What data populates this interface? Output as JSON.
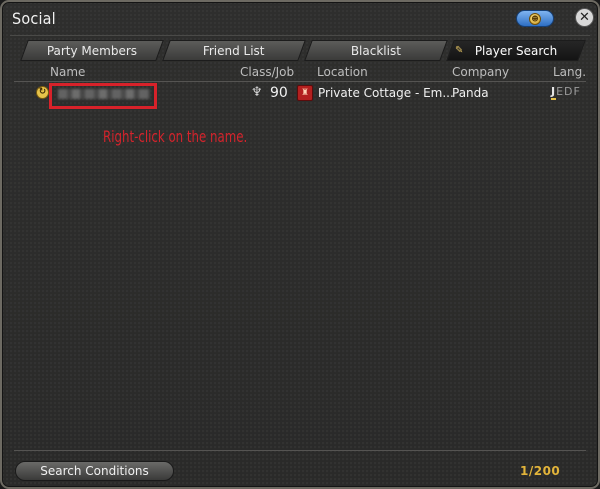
{
  "window": {
    "title": "Social",
    "coin_symbol": "☻",
    "close_symbol": "✕"
  },
  "tabs": [
    {
      "label": "Party Members",
      "active": false
    },
    {
      "label": "Friend List",
      "active": false
    },
    {
      "label": "Blacklist",
      "active": false
    },
    {
      "label": "Player Search",
      "active": true
    }
  ],
  "columns": {
    "name": "Name",
    "class_job": "Class/Job",
    "location": "Location",
    "company": "Company",
    "lang": "Lang."
  },
  "results": [
    {
      "status_symbol": "↻",
      "job_symbol": "♆",
      "level": "90",
      "location_symbol": "♜",
      "location": "Private Cottage - Em...",
      "company": "Panda",
      "lang_active": "J",
      "lang_rest": "EDF"
    }
  ],
  "annotation": "Right-click on the name.",
  "footer": {
    "search_conditions": "Search Conditions",
    "page_count": "1/200"
  },
  "colors": {
    "accent_red": "#d8222a",
    "accent_gold": "#e2b43a",
    "active_tab": "#141414"
  }
}
